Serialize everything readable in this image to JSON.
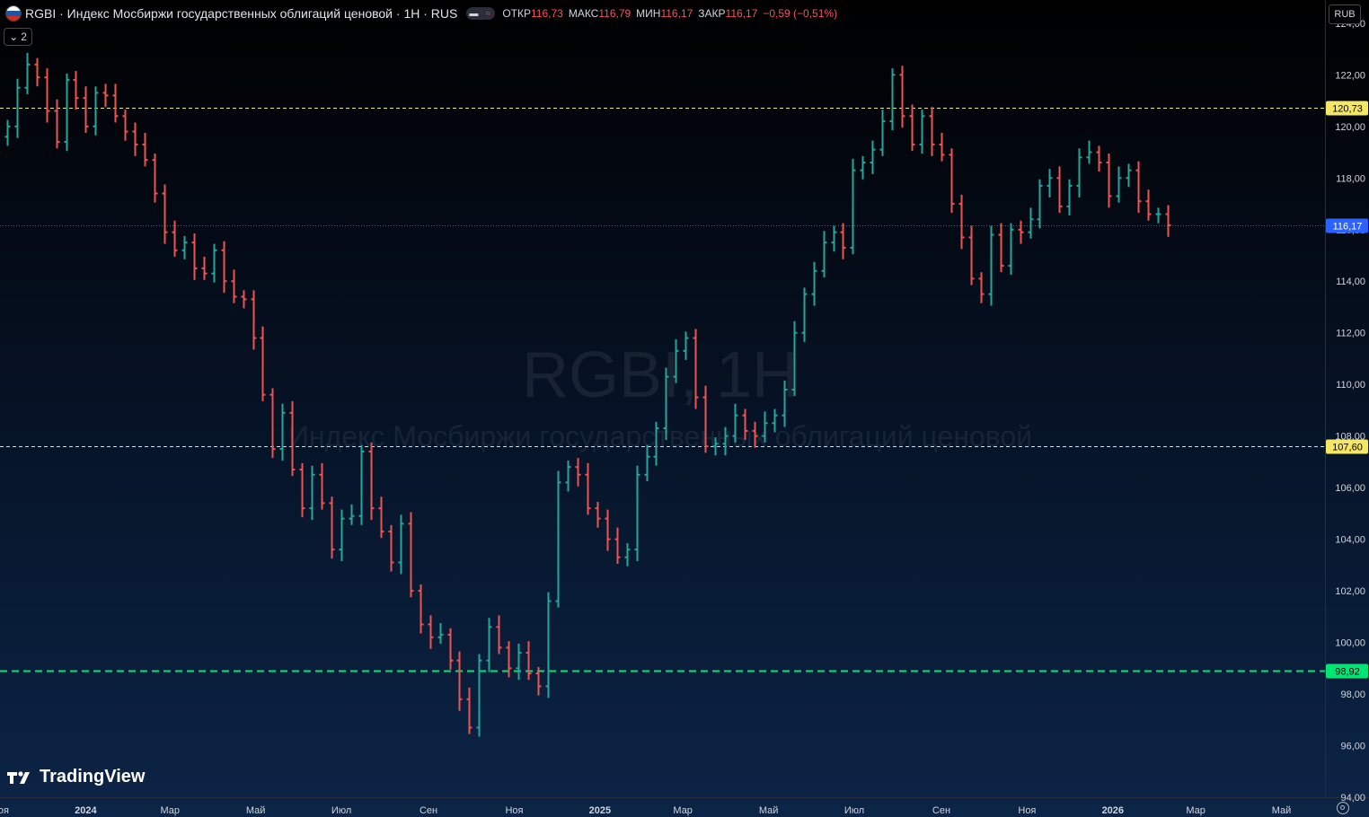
{
  "header": {
    "title": "RGBI · Индекс Мосбиржи государственных облигаций ценовой · 1Н · RUS",
    "ohlc": [
      {
        "k": "ОТКР",
        "v": "116,73"
      },
      {
        "k": "МАКС",
        "v": "116,79"
      },
      {
        "k": "МИН",
        "v": "116,17"
      },
      {
        "k": "ЗАКР",
        "v": "116,17"
      }
    ],
    "change": "−0,59 (−0,51%)",
    "collapse_count": "2",
    "currency": "RUB"
  },
  "watermark": {
    "symbol": "RGBI, 1Н",
    "description": "Индекс Мосбиржи государственных облигаций ценовой"
  },
  "logo": {
    "text": "TradingView"
  },
  "colors": {
    "up": "#26a69a",
    "down": "#ef5350",
    "current_line": "#2962ff",
    "level_line": "#f0e68c",
    "support_line": "#00e676"
  },
  "chart_data": {
    "type": "ohlc",
    "interval": "1W",
    "ylim": [
      94,
      124.9
    ],
    "y_ticks": [
      "124,00",
      "122,00",
      "120,00",
      "118,00",
      "116,00",
      "114,00",
      "112,00",
      "110,00",
      "108,00",
      "106,00",
      "104,00",
      "102,00",
      "100,00",
      "98,00",
      "96,00",
      "94,00"
    ],
    "x_labels": [
      {
        "label": "Ноя",
        "date": "2023-11-01"
      },
      {
        "label": "2024",
        "date": "2024-01-01"
      },
      {
        "label": "Мар",
        "date": "2024-03-01"
      },
      {
        "label": "Май",
        "date": "2024-05-01"
      },
      {
        "label": "Июл",
        "date": "2024-07-01"
      },
      {
        "label": "Сен",
        "date": "2024-09-01"
      },
      {
        "label": "Ноя",
        "date": "2024-11-01"
      },
      {
        "label": "2025",
        "date": "2025-01-01"
      },
      {
        "label": "Мар",
        "date": "2025-03-01"
      },
      {
        "label": "Май",
        "date": "2025-05-01"
      },
      {
        "label": "Июл",
        "date": "2025-07-01"
      },
      {
        "label": "Сен",
        "date": "2025-09-01"
      },
      {
        "label": "Ноя",
        "date": "2025-11-01"
      },
      {
        "label": "2026",
        "date": "2026-01-01"
      },
      {
        "label": "Мар",
        "date": "2026-03-01"
      },
      {
        "label": "Май",
        "date": "2026-05-01"
      }
    ],
    "x_range": [
      "2023-11-01",
      "2026-06-01"
    ],
    "start_date": "2023-11-06",
    "closes": [
      120.0,
      121.5,
      122.4,
      121.9,
      120.6,
      119.4,
      121.8,
      121.1,
      120.0,
      121.3,
      121.2,
      120.4,
      119.8,
      119.3,
      118.7,
      117.4,
      115.9,
      115.2,
      115.5,
      114.5,
      114.3,
      115.2,
      114.0,
      113.4,
      113.3,
      111.8,
      109.6,
      107.5,
      108.9,
      106.7,
      105.2,
      106.5,
      105.4,
      103.6,
      104.8,
      104.9,
      107.4,
      105.2,
      104.3,
      103.1,
      104.6,
      102.0,
      100.7,
      100.2,
      100.3,
      99.3,
      97.8,
      96.7,
      99.3,
      100.6,
      99.8,
      99.0,
      99.6,
      98.8,
      98.3,
      101.6,
      106.2,
      106.8,
      106.5,
      105.2,
      104.8,
      104.0,
      103.3,
      103.6,
      106.5,
      107.2,
      108.3,
      110.3,
      111.3,
      111.8,
      109.5,
      107.6,
      107.7,
      108.0,
      108.8,
      108.2,
      108.0,
      108.5,
      108.8,
      109.8,
      112.0,
      113.5,
      114.4,
      115.5,
      115.9,
      115.3,
      118.3,
      118.6,
      119.1,
      120.2,
      122.0,
      120.4,
      119.3,
      120.4,
      119.3,
      118.9,
      117.0,
      115.7,
      114.1,
      113.5,
      115.8,
      114.6,
      116.0,
      115.9,
      116.4,
      117.7,
      118.0,
      116.9,
      117.7,
      118.8,
      119.0,
      118.6,
      117.3,
      118.0,
      118.3,
      117.1,
      116.6,
      116.6,
      116.17
    ],
    "levels": [
      {
        "value": 120.73,
        "label": "120,73",
        "style": "dashed-level"
      },
      {
        "value": 116.17,
        "label": "116,17",
        "style": "dotted-current"
      },
      {
        "value": 107.6,
        "label": "107,60",
        "style": "dashed-level"
      },
      {
        "value": 98.92,
        "label": "98,92",
        "style": "dashed-support"
      }
    ]
  }
}
